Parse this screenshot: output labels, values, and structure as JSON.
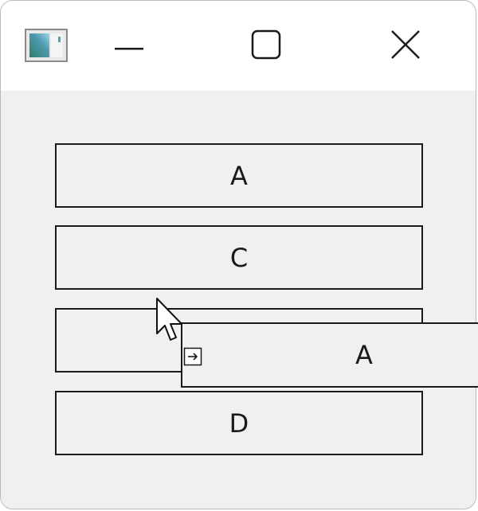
{
  "window": {
    "app_icon": "app-window-icon",
    "controls": {
      "minimize_icon": "minimize-icon",
      "maximize_icon": "maximize-icon",
      "close_icon": "close-icon"
    }
  },
  "buttons": [
    {
      "label": "A"
    },
    {
      "label": "C"
    },
    {
      "label": ""
    },
    {
      "label": "D"
    }
  ],
  "drag_ghost": {
    "label": "A",
    "icon": "move-drop-icon"
  },
  "cursor": {
    "icon": "mouse-pointer-icon"
  }
}
